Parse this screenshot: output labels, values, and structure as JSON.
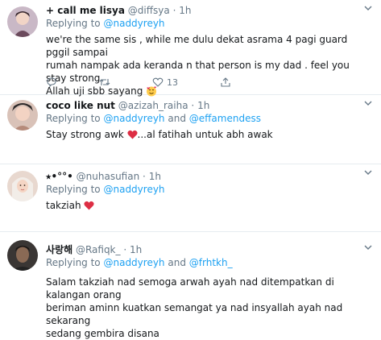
{
  "tweets": [
    {
      "name": "+ call me lisya",
      "handle": "@diffsya",
      "dot": "·",
      "time": "1h",
      "replying_prefix": "Replying to",
      "mentions": [
        "@naddyreyh"
      ],
      "text_line1": "we're the same sis , while me dulu dekat asrama 4 pagi guard pggil sampai",
      "text_line2": "rumah nampak ada keranda n that person is my dad . feel you stay strong",
      "text_line3": "Allah uji sbb sayang",
      "like_count": "13"
    },
    {
      "name": "coco like nut",
      "handle": "@azizah_raiha",
      "dot": "·",
      "time": "1h",
      "replying_prefix": "Replying to",
      "mentions": [
        "@naddyreyh",
        "@effamendess"
      ],
      "mention_joiner": "and",
      "text_before": "Stay strong awk",
      "text_after": "...al fatihah untuk abh awak"
    },
    {
      "name": "⭑•°°•",
      "handle": "@nuhasufian",
      "dot": "·",
      "time": "1h",
      "replying_prefix": "Replying to",
      "mentions": [
        "@naddyreyh"
      ],
      "text_before": "takziah"
    },
    {
      "name": "사랑해",
      "handle": "@Rafiqk_",
      "dot": "·",
      "time": "1h",
      "replying_prefix": "Replying to",
      "mentions": [
        "@naddyreyh",
        "@frhtkh_"
      ],
      "mention_joiner": "and",
      "text_line1": "Salam takziah nad semoga arwah ayah nad ditempatkan di kalangan orang",
      "text_line2": "beriman aminn kuatkan semangat ya nad insyallah ayah nad sekarang",
      "text_line3": "sedang gembira disana"
    }
  ],
  "icons": {
    "reply": "reply-icon",
    "retweet": "retweet-icon",
    "like": "like-icon",
    "share": "share-icon",
    "caret": "chevron-down-icon"
  },
  "colors": {
    "accent": "#1da1f2",
    "muted": "#657786",
    "heart": "#e0245e",
    "divider": "#e6ecf0"
  }
}
